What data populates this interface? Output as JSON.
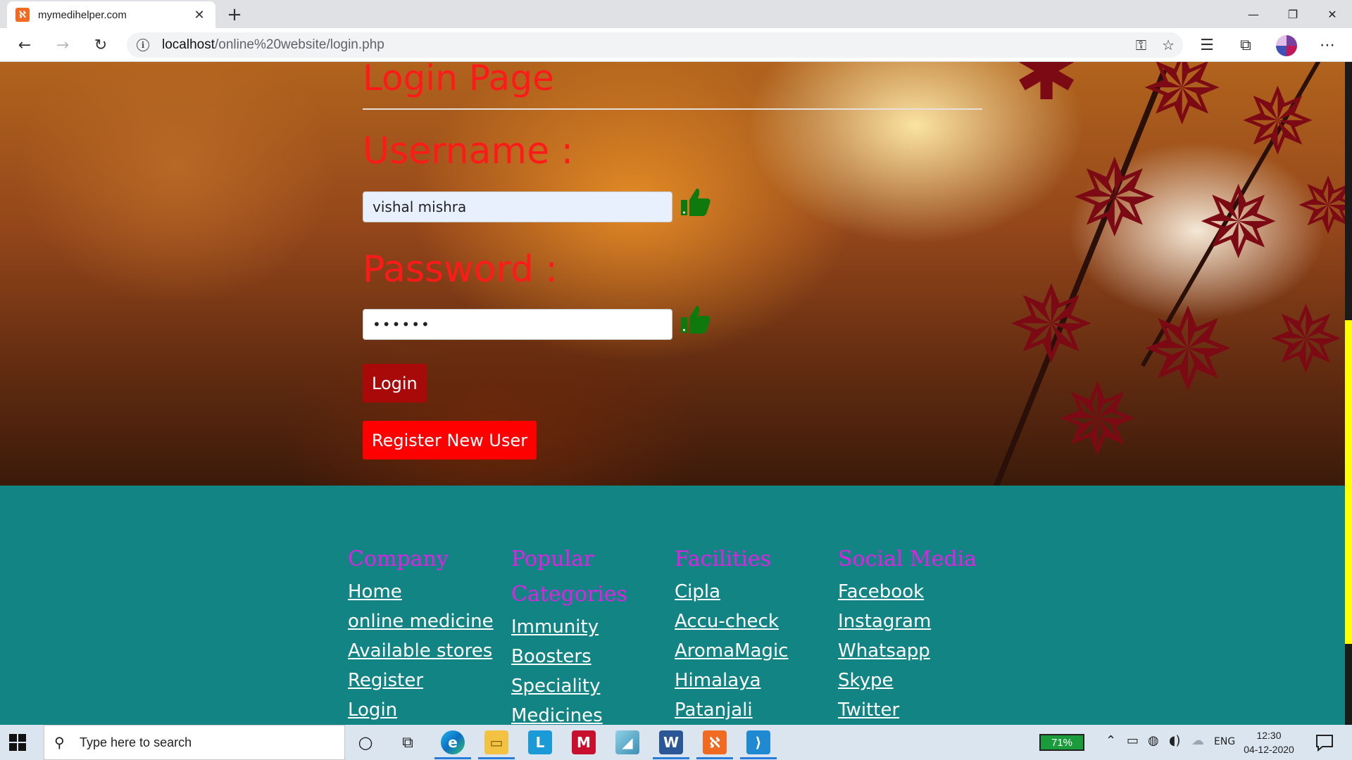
{
  "browser": {
    "tab_title": "mymedihelper.com",
    "url_host": "localhost",
    "url_path": "/online%20website/login.php"
  },
  "page": {
    "title": "Login Page",
    "username_label": "Username :",
    "username_value": "vishal mishra",
    "password_label": "Password :",
    "password_value": "••••••",
    "login_button": "Login",
    "register_button": "Register New User"
  },
  "footer": {
    "columns": [
      {
        "heading": "Company",
        "links": [
          "Home",
          "online medicine",
          "Available stores",
          "Register",
          "Login"
        ]
      },
      {
        "heading": "Popular Categories",
        "links": [
          "Immunity",
          "Boosters",
          "Speciality",
          "Medicines"
        ]
      },
      {
        "heading": "Facilities",
        "links": [
          "Cipla",
          "Accu-check",
          "AromaMagic",
          "Himalaya",
          "Patanjali"
        ]
      },
      {
        "heading": "Social Media",
        "links": [
          "Facebook",
          "Instagram",
          "Whatsapp",
          "Skype",
          "Twitter"
        ]
      }
    ]
  },
  "taskbar": {
    "search_placeholder": "Type here to search",
    "battery": "71%",
    "language": "ENG",
    "time": "12:30",
    "date": "04-12-2020"
  },
  "colors": {
    "title_red": "#ff1a1a",
    "login_button": "#a80a0a",
    "register_button": "#ff0000",
    "footer_bg": "#128484",
    "footer_heading": "#e61ee6"
  }
}
